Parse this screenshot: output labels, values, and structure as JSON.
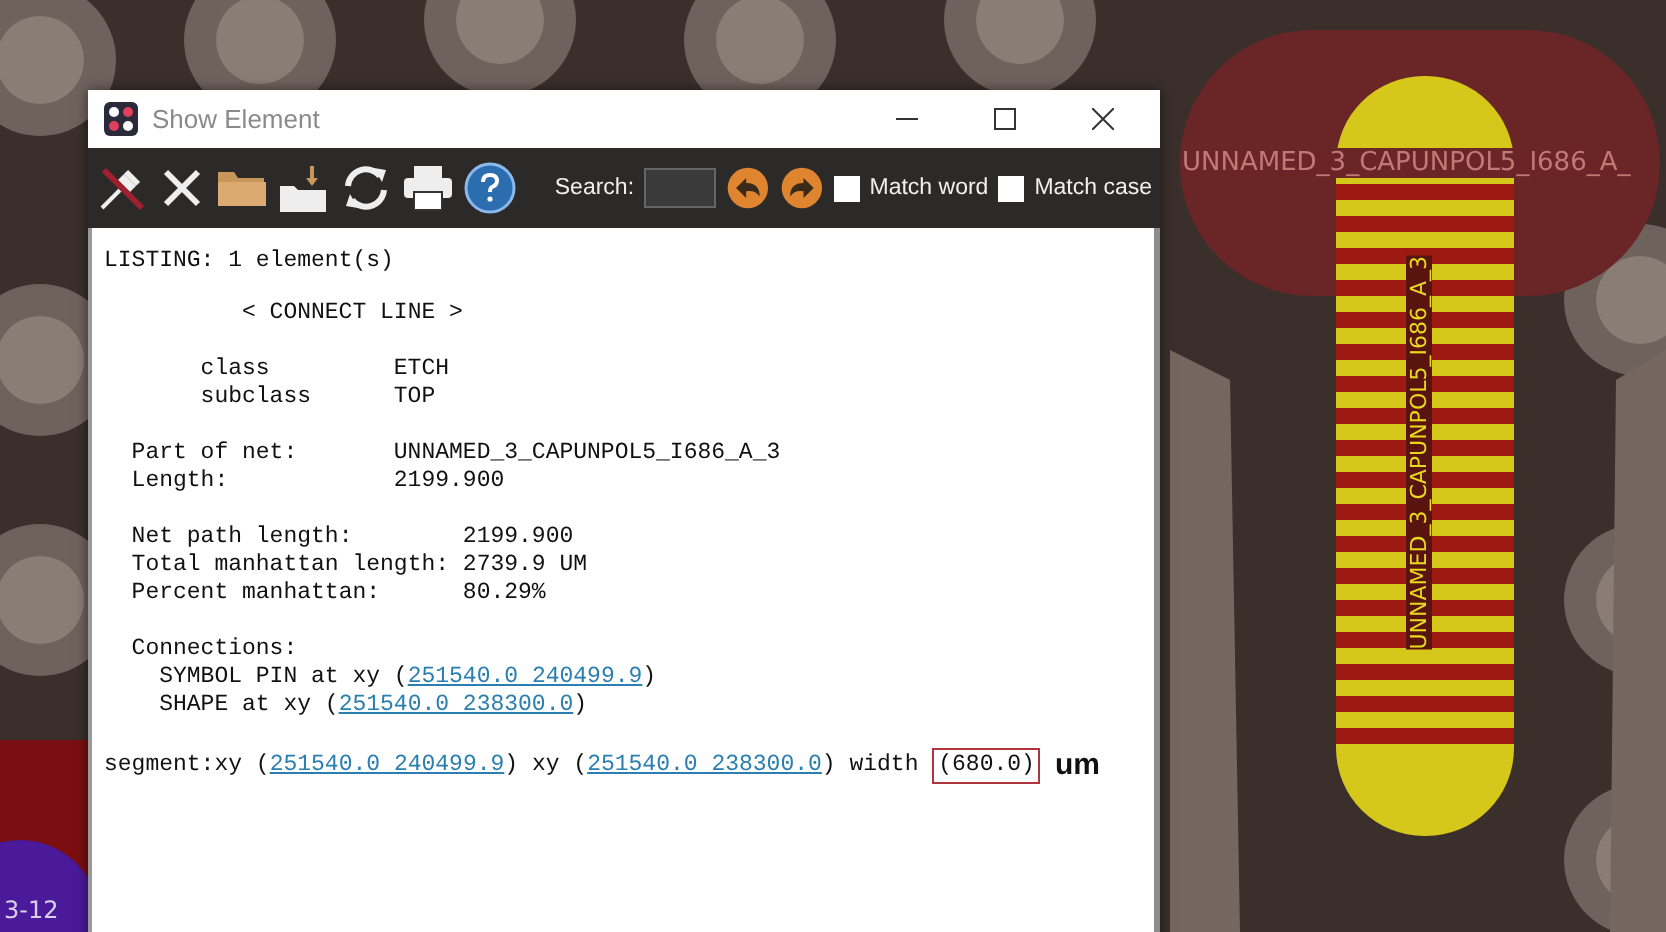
{
  "canvas": {
    "net_label": "UNNAMED_3_CAPUNPOL5_I686_A_",
    "pad_label": "UNNAMED_3_CAPUNPOL5_I686_A_3",
    "pin_label": "3-12"
  },
  "window": {
    "title": "Show Element"
  },
  "toolbar": {
    "search": {
      "label": "Search:"
    },
    "options": [
      {
        "label": "Match word",
        "checked": false
      },
      {
        "label": "Match case",
        "checked": false
      }
    ]
  },
  "listing": {
    "title": "LISTING: 1 element(s)",
    "element_type": "< CONNECT LINE >",
    "layer_fields": [
      {
        "label": "class",
        "value": "ETCH"
      },
      {
        "label": "subclass",
        "value": "TOP"
      }
    ],
    "net_fields": [
      {
        "label": "Part of net:",
        "value": "UNNAMED_3_CAPUNPOL5_I686_A_3"
      },
      {
        "label": "Length:",
        "value": "2199.900"
      }
    ],
    "path_fields": [
      {
        "label": "Net path length:",
        "value": "2199.900"
      },
      {
        "label": "Total manhattan length:",
        "value": "2739.9 UM"
      },
      {
        "label": "Percent manhattan:",
        "value": "80.29%"
      }
    ],
    "connections": {
      "heading": "Connections:",
      "items": [
        {
          "prefix": "SYMBOL PIN at xy (",
          "link": "251540.0 240499.9",
          "suffix": ")"
        },
        {
          "prefix": "SHAPE at xy (",
          "link": "251540.0 238300.0",
          "suffix": ")"
        }
      ]
    },
    "segment": {
      "prefix": "segment:xy (",
      "start": "251540.0 240499.9",
      "middle": ") xy (",
      "end": "251540.0 238300.0",
      "before_width": ") width ",
      "width": "(680.0)",
      "unit_note": "um"
    }
  }
}
